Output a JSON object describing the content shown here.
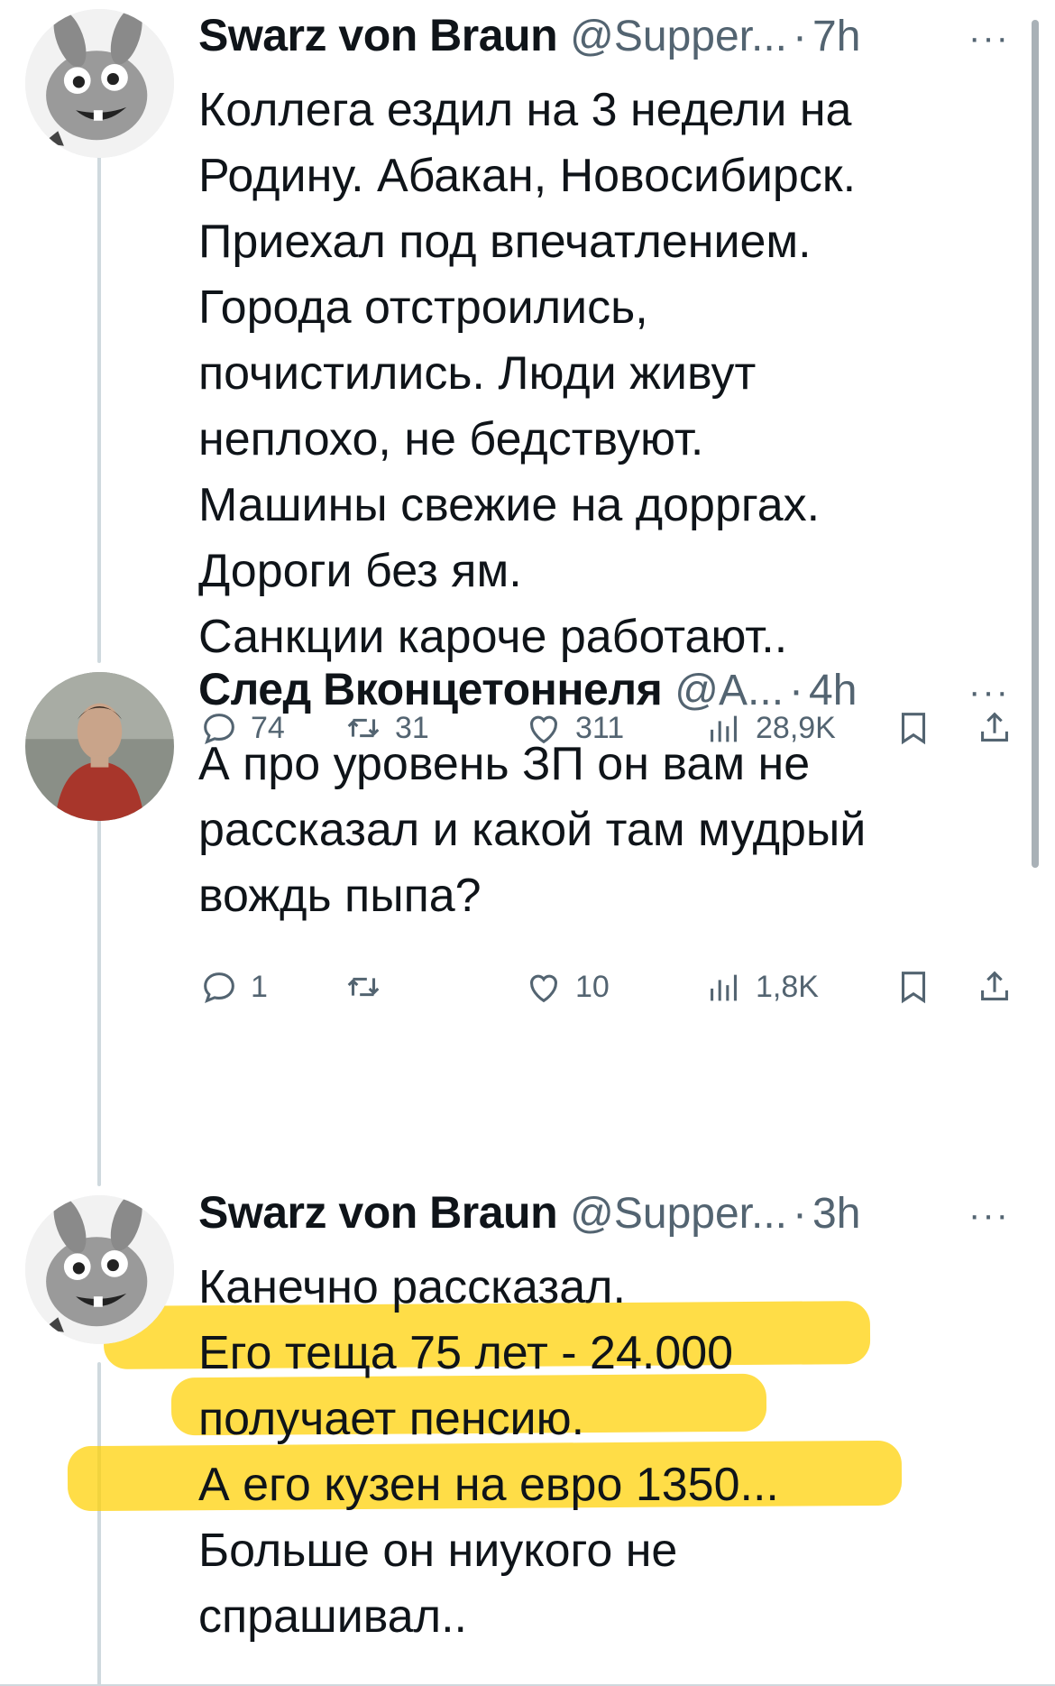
{
  "tweets": [
    {
      "name": "Swarz von Braun",
      "handle": "@Supper...",
      "time": "7h",
      "lines": [
        "Коллега ездил на 3 недели на",
        "Родину. Абакан, Новосибирск.",
        "Приехал под впечатлением.",
        "Города отстроились,",
        "почистились. Люди живут",
        "неплохо, не бедствуют.",
        "Машины свежие на дорргах.",
        "Дороги без ям.",
        "Санкции кароче работают.."
      ],
      "replies": "74",
      "retweets": "31",
      "likes": "311",
      "views": "28,9K"
    },
    {
      "name": "След Вконцетоннеля",
      "handle": "@A...",
      "time": "4h",
      "lines": [
        "А про уровень ЗП он вам не",
        "рассказал и какой там мудрый",
        "вождь пыпа?"
      ],
      "replies": "1",
      "retweets": "",
      "likes": "10",
      "views": "1,8K"
    },
    {
      "name": "Swarz von Braun",
      "handle": "@Supper...",
      "time": "3h",
      "lines": [
        "Канечно рассказал.",
        "Его теща 75 лет - 24.000",
        "получает пенсию.",
        "А его кузен на евро 1350...",
        "Больше он ниукого не",
        "спрашивал.."
      ]
    }
  ],
  "ui": {
    "separator": "·",
    "more": "···"
  },
  "icons": [
    "reply-icon",
    "retweet-icon",
    "like-icon",
    "views-icon",
    "bookmark-icon",
    "share-icon",
    "more-icon"
  ],
  "colors": {
    "text": "#0f1419",
    "muted": "#536471",
    "highlight": "#ffd000"
  }
}
